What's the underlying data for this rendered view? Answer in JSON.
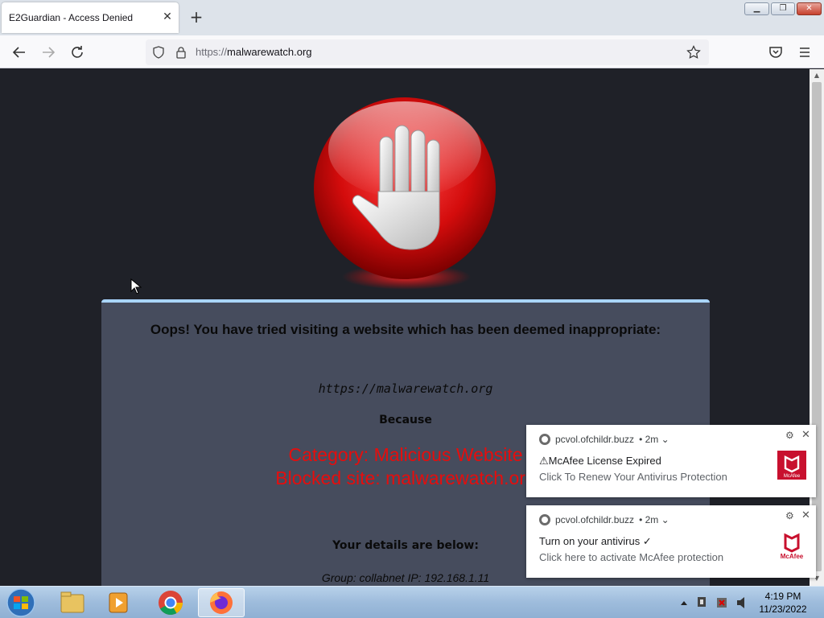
{
  "browser": {
    "tab_title": "E2Guardian - Access Denied",
    "tab_close": "✕",
    "new_tab": "+",
    "url_scheme": "https://",
    "url_host": "malwarewatch.org"
  },
  "page": {
    "heading": "Oops! You have tried visiting a website which has been deemed inappropriate:",
    "blocked_url": "https://malwarewatch.org",
    "because": "Because",
    "category_line": "Category: Malicious Website",
    "blocked_line": "Blocked site: malwarewatch.org",
    "details_heading": "Your details are below:",
    "details_line": "Group: collabnet   IP: 192.168.1.11"
  },
  "notifications": [
    {
      "source": "pcvol.ofchildr.buzz",
      "age": "• 2m ⌄",
      "title": "⚠McAfee License Expired",
      "body": "Click To Renew Your Antivirus Protection",
      "logo_text": "McAfee"
    },
    {
      "source": "pcvol.ofchildr.buzz",
      "age": "• 2m ⌄",
      "title": "Turn on your antivirus ✓",
      "body": "Click here to activate McAfee protection",
      "logo_text": "McAfee"
    }
  ],
  "taskbar": {
    "time": "4:19 PM",
    "date": "11/23/2022"
  },
  "colors": {
    "page_bg": "#1f2128",
    "panel_bg": "#464c5d",
    "panel_top_border": "#a9d5ff",
    "reason_red": "#e60d0d",
    "mcafee_red": "#c8102e"
  }
}
